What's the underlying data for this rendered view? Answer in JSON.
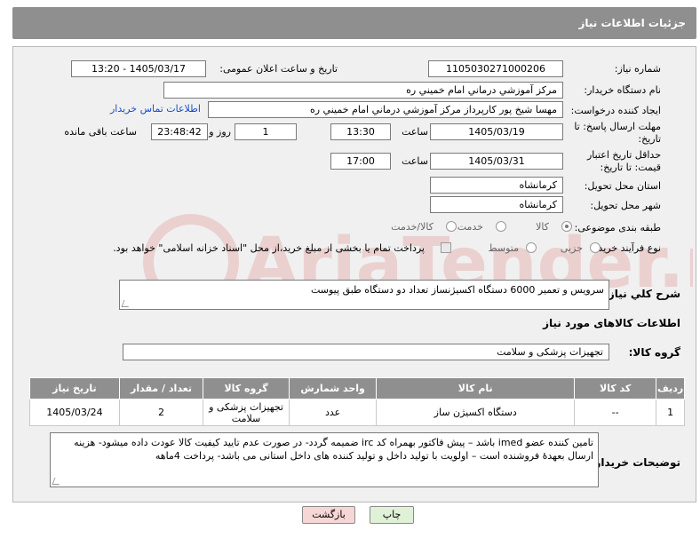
{
  "title": "جزئیات اطلاعات نیاز",
  "labels": {
    "need_number": "شماره نیاز:",
    "announce_datetime": "تاریخ و ساعت اعلان عمومی:",
    "buyer_org": "نام دستگاه خریدار:",
    "requester": "ایجاد کننده درخواست:",
    "reply_deadline": "مهلت ارسال پاسخ: تا تاریخ:",
    "time": "ساعت",
    "day_and": "روز و",
    "remaining_time": "ساعت باقی مانده",
    "min_price_validity": "حداقل تاریخ اعتبار قیمت: تا تاریخ:",
    "delivery_province": "استان محل تحویل:",
    "delivery_city": "شهر محل تحویل:",
    "subject_category": "طبقه بندی موضوعی:",
    "purchase_process": "نوع فرآیند خرید :",
    "need_description": "شرح کلي نياز:",
    "items_info": "اطلاعات کالاهای مورد نیاز",
    "goods_group": "گروه کالا:",
    "buyer_notes": "توضیحات خریدار:"
  },
  "values": {
    "need_number": "1105030271000206",
    "announce_datetime": "1405/03/17 - 13:20",
    "buyer_org": "مرکز آموزشي درماني امام خميني ره",
    "requester": "مهسا شیخ پور کارپرداز مرکز آموزشي درماني امام خميني ره",
    "contact_link": "اطلاعات تماس خریدار",
    "reply_date": "1405/03/19",
    "reply_time": "13:30",
    "reply_days": "1",
    "reply_remaining": "23:48:42",
    "price_date": "1405/03/31",
    "price_time": "17:00",
    "province": "کرمانشاه",
    "city": "کرمانشاه",
    "need_description": "سرویس و تعمیر 6000 دستگاه اکسیژنساز تعداد دو دستگاه طبق پیوست",
    "goods_group": "تجهیزات پزشکی و سلامت",
    "buyer_notes": "تامین کننده عضو imed باشد – پیش فاکتور بهمراه کد irc ضمیمه گردد- در صورت عدم تایید کیفیت کالا عودت داده میشود- هزینه ارسال بعهدهٔ فروشنده است – اولویت با تولید داخل و تولید کننده های داخل استانی می باشد- پرداخت 4ماهه"
  },
  "category_options": [
    {
      "label": "کالا",
      "selected": true
    },
    {
      "label": "خدمت",
      "selected": false
    },
    {
      "label": "کالا/خدمت",
      "selected": false
    }
  ],
  "process_options": [
    {
      "label": "جزیی",
      "selected": false
    },
    {
      "label": "متوسط",
      "selected": false
    }
  ],
  "payment_note": "پرداخت تمام یا بخشی از مبلغ خرید،از محل \"اسناد خزانه اسلامی\" خواهد بود.",
  "table": {
    "headers": [
      "ردیف",
      "کد کالا",
      "نام کالا",
      "واحد شمارش",
      "گروه کالا",
      "تعداد / مقدار",
      "تاریخ نیاز"
    ],
    "rows": [
      [
        "1",
        "--",
        "دستگاه اکسیژن ساز",
        "عدد",
        "تجهیزات پزشکی و سلامت",
        "2",
        "1405/03/24"
      ]
    ]
  },
  "buttons": {
    "print": "چاپ",
    "back": "بازگشت"
  },
  "watermark": "AriaTender.neT",
  "colors": {
    "header_gray": "#8f8f8f",
    "link_blue": "#1a4fc4",
    "back_button": "#f7d6d6",
    "print_button": "#dff2d8"
  }
}
